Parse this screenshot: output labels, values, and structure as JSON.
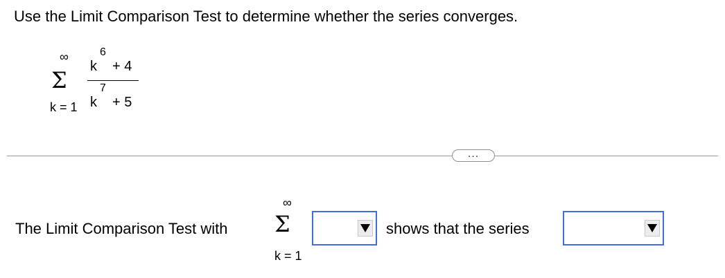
{
  "question": {
    "text": "Use the Limit Comparison Test to determine whether the series converges."
  },
  "series": {
    "sigma": "Σ",
    "upper": "∞",
    "lower": "k = 1",
    "numerator_base": "k",
    "numerator_exp": "6",
    "numerator_rest": "+ 4",
    "denominator_base": "k",
    "denominator_exp": "7",
    "denominator_rest": "+ 5"
  },
  "more_button": {
    "label": "..."
  },
  "answer": {
    "prefix": "The Limit Comparison Test with",
    "sigma": "Σ",
    "upper": "∞",
    "lower": "k = 1",
    "middle": "shows that the series",
    "comparison_dropdown": {
      "selected": ""
    },
    "conclusion_dropdown": {
      "selected": ""
    }
  },
  "colors": {
    "dropdown_border": "#3d6fd6",
    "divider": "#9a9a9a"
  }
}
